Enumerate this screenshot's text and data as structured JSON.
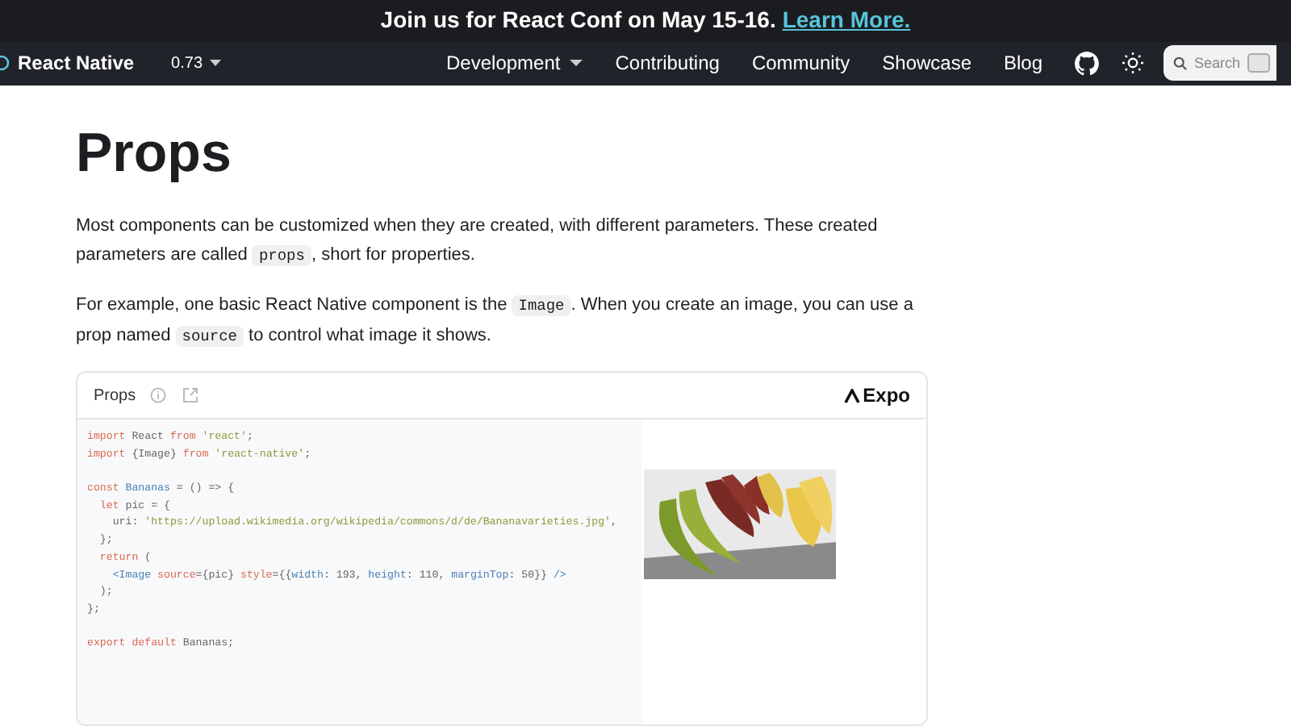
{
  "banner": {
    "text": "Join us for React Conf on May 15-16.",
    "link": "Learn More."
  },
  "navbar": {
    "brand": "React Native",
    "version": "0.73",
    "links": [
      {
        "label": "Development",
        "dropdown": true
      },
      {
        "label": "Contributing",
        "dropdown": false
      },
      {
        "label": "Community",
        "dropdown": false
      },
      {
        "label": "Showcase",
        "dropdown": false
      },
      {
        "label": "Blog",
        "dropdown": false
      }
    ],
    "search": {
      "placeholder": "Search"
    }
  },
  "page": {
    "title": "Props",
    "paragraphs": [
      [
        {
          "kind": "text",
          "text": "Most components can be customized when they are created, with different parameters. These created parameters are called "
        },
        {
          "kind": "code",
          "text": "props"
        },
        {
          "kind": "text",
          "text": ", short for properties."
        }
      ],
      [
        {
          "kind": "text",
          "text": "For example, one basic React Native component is the "
        },
        {
          "kind": "code",
          "text": "Image"
        },
        {
          "kind": "text",
          "text": ". When you create an image, you can use a prop named "
        },
        {
          "kind": "code",
          "text": "source"
        },
        {
          "kind": "text",
          "text": " to control what image it shows."
        }
      ]
    ]
  },
  "snack": {
    "title": "Props",
    "brand": "Expo",
    "code": [
      {
        "kind": "code",
        "tokens": [
          {
            "kind": "kw",
            "text": "import"
          },
          {
            "kind": "plain",
            "text": " React "
          },
          {
            "kind": "kw",
            "text": "from"
          },
          {
            "kind": "str",
            "text": " 'react'"
          },
          {
            "kind": "plain",
            "text": ";"
          }
        ]
      },
      {
        "kind": "code",
        "tokens": [
          {
            "kind": "kw",
            "text": "import"
          },
          {
            "kind": "plain",
            "text": " {Image} "
          },
          {
            "kind": "kw",
            "text": "from"
          },
          {
            "kind": "str",
            "text": " 'react-native'"
          },
          {
            "kind": "plain",
            "text": ";"
          }
        ]
      },
      {
        "kind": "blank"
      },
      {
        "kind": "code",
        "tokens": [
          {
            "kind": "kw",
            "text": "const"
          },
          {
            "kind": "attr",
            "text": " Bananas"
          },
          {
            "kind": "plain",
            "text": " = () => {"
          }
        ]
      },
      {
        "kind": "code",
        "tokens": [
          {
            "kind": "kw",
            "text": "  let"
          },
          {
            "kind": "plain",
            "text": " pic = {"
          }
        ]
      },
      {
        "kind": "code",
        "tokens": [
          {
            "kind": "plain",
            "text": "    uri: "
          },
          {
            "kind": "str",
            "text": "'https://upload.wikimedia.org/wikipedia/commons/d/de/Bananavarieties.jpg'"
          },
          {
            "kind": "plain",
            "text": ","
          }
        ]
      },
      {
        "kind": "code",
        "tokens": [
          {
            "kind": "plain",
            "text": "  };"
          }
        ]
      },
      {
        "kind": "code",
        "tokens": [
          {
            "kind": "kw",
            "text": "  return"
          },
          {
            "kind": "plain",
            "text": " ("
          }
        ]
      },
      {
        "kind": "code",
        "tokens": [
          {
            "kind": "attr",
            "text": "    <Image"
          },
          {
            "kind": "kw",
            "text": " source"
          },
          {
            "kind": "plain",
            "text": "={pic} "
          },
          {
            "kind": "kw",
            "text": "style"
          },
          {
            "kind": "plain",
            "text": "={{"
          },
          {
            "kind": "attr",
            "text": "width"
          },
          {
            "kind": "plain",
            "text": ": 193, "
          },
          {
            "kind": "attr",
            "text": "height"
          },
          {
            "kind": "plain",
            "text": ": 110, "
          },
          {
            "kind": "attr",
            "text": "marginTop"
          },
          {
            "kind": "plain",
            "text": ": 50}} "
          },
          {
            "kind": "attr",
            "text": "/>"
          }
        ]
      },
      {
        "kind": "code",
        "tokens": [
          {
            "kind": "plain",
            "text": "  );"
          }
        ]
      },
      {
        "kind": "code",
        "tokens": [
          {
            "kind": "plain",
            "text": "};"
          }
        ]
      },
      {
        "kind": "blank"
      },
      {
        "kind": "code",
        "tokens": [
          {
            "kind": "kw",
            "text": "export default"
          },
          {
            "kind": "plain",
            "text": " Bananas;"
          }
        ]
      }
    ]
  }
}
